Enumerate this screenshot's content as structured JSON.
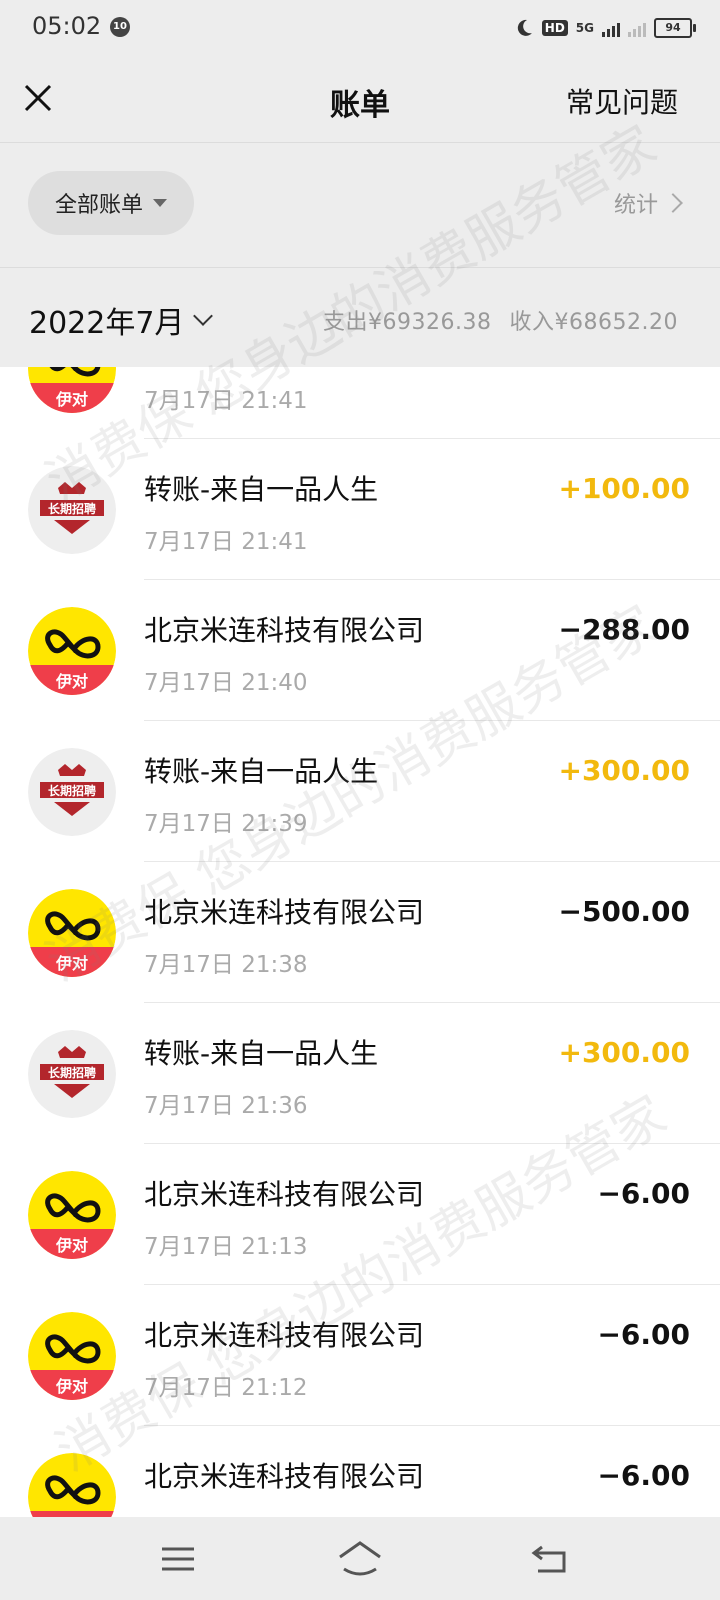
{
  "status_bar": {
    "time": "05:02",
    "badge": "10",
    "hd_label": "HD",
    "network": "5G",
    "battery": "94"
  },
  "nav": {
    "title": "账单",
    "faq_label": "常见问题"
  },
  "filter": {
    "all_bills_label": "全部账单",
    "stats_label": "统计"
  },
  "month": {
    "label": "2022年7月",
    "expense": "支出¥69326.38",
    "income": "收入¥68652.20"
  },
  "avatars": {
    "yidui_text": "伊对",
    "recruit_text": "长期招聘"
  },
  "transactions": [
    {
      "merchant": "",
      "time": "7月17日 21:41",
      "amount": "",
      "type": "negative",
      "avatar": "yidui"
    },
    {
      "merchant": "转账-来自一品人生",
      "time": "7月17日 21:41",
      "amount": "+100.00",
      "type": "positive",
      "avatar": "recruit"
    },
    {
      "merchant": "北京米连科技有限公司",
      "time": "7月17日 21:40",
      "amount": "−288.00",
      "type": "negative",
      "avatar": "yidui"
    },
    {
      "merchant": "转账-来自一品人生",
      "time": "7月17日 21:39",
      "amount": "+300.00",
      "type": "positive",
      "avatar": "recruit"
    },
    {
      "merchant": "北京米连科技有限公司",
      "time": "7月17日 21:38",
      "amount": "−500.00",
      "type": "negative",
      "avatar": "yidui"
    },
    {
      "merchant": "转账-来自一品人生",
      "time": "7月17日 21:36",
      "amount": "+300.00",
      "type": "positive",
      "avatar": "recruit"
    },
    {
      "merchant": "北京米连科技有限公司",
      "time": "7月17日 21:13",
      "amount": "−6.00",
      "type": "negative",
      "avatar": "yidui"
    },
    {
      "merchant": "北京米连科技有限公司",
      "time": "7月17日 21:12",
      "amount": "−6.00",
      "type": "negative",
      "avatar": "yidui"
    },
    {
      "merchant": "北京米连科技有限公司",
      "time": "",
      "amount": "−6.00",
      "type": "negative",
      "avatar": "yidui"
    }
  ],
  "watermark_text": "消费保 您身边的消费服务管家",
  "colors": {
    "positive": "#f2b90e",
    "negative": "#111111",
    "header_bg": "#ededed",
    "yidui_yellow": "#ffe600",
    "yidui_red": "#ef3e4a",
    "recruit_red": "#b3262c"
  },
  "icons": [
    "close-icon",
    "caret-down-icon",
    "chevron-right-icon",
    "chevron-down-icon",
    "menu-icon",
    "home-icon",
    "back-icon"
  ]
}
